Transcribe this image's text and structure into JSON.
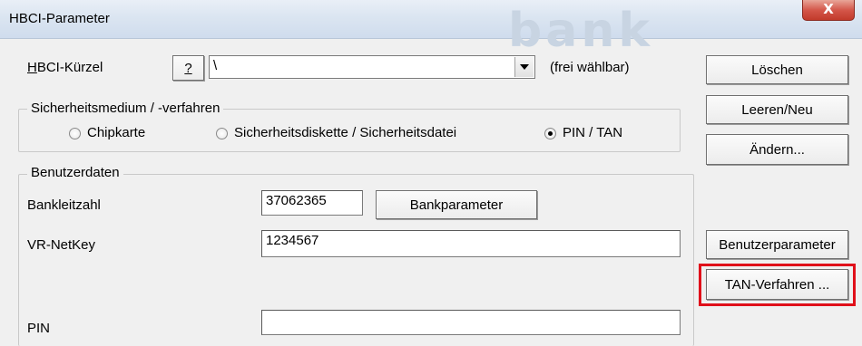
{
  "window": {
    "title": "HBCI-Parameter",
    "ghost_text": "bank",
    "close_label": "X"
  },
  "hbci": {
    "label": "HBCI-Kürzel",
    "help_label": "?",
    "combo_value": "\\",
    "hint": "(frei wählbar)"
  },
  "security": {
    "legend": "Sicherheitsmedium / -verfahren",
    "options": [
      {
        "label": "Chipkarte",
        "checked": false
      },
      {
        "label": "Sicherheitsdiskette / Sicherheitsdatei",
        "checked": false
      },
      {
        "label": "PIN / TAN",
        "checked": true
      }
    ]
  },
  "user": {
    "legend": "Benutzerdaten",
    "blz_label": "Bankleitzahl",
    "blz_value": "37062365",
    "bankparam_label": "Bankparameter",
    "netkey_label": "VR-NetKey",
    "netkey_value": "1234567",
    "pin_label": "PIN",
    "pin_value": ""
  },
  "side_buttons": {
    "delete": "Löschen",
    "clear_new": "Leeren/Neu",
    "change": "Ändern...",
    "user_params": "Benutzerparameter",
    "tan_method": "TAN-Verfahren ..."
  },
  "colors": {
    "highlight": "#e0101a"
  }
}
